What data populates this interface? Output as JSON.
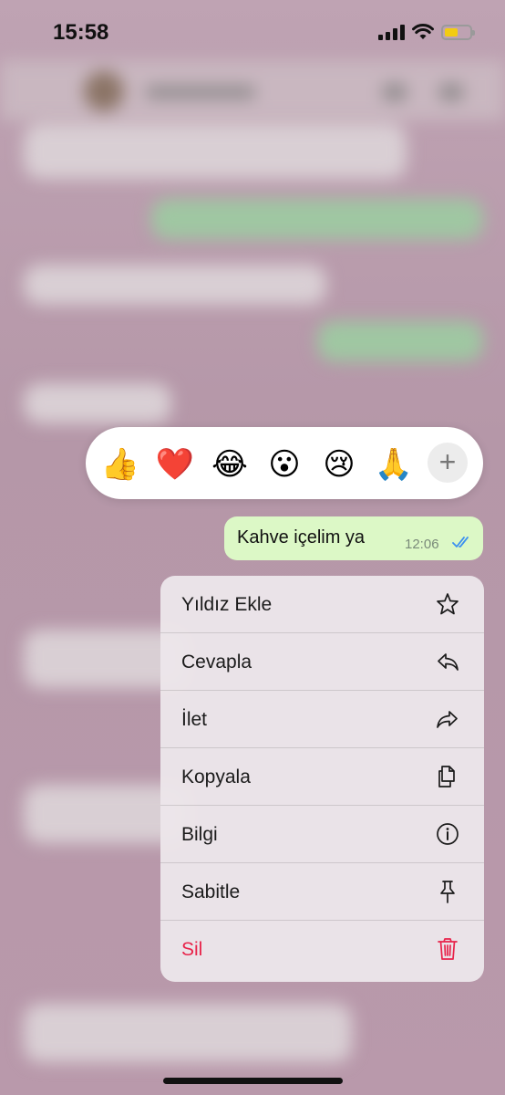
{
  "status_bar": {
    "time": "15:58",
    "battery_level": 0.55,
    "battery_color": "#f2cc12"
  },
  "reactions": {
    "emojis": [
      {
        "glyph": "👍",
        "name": "thumbs-up"
      },
      {
        "glyph": "❤️",
        "name": "red-heart"
      },
      {
        "glyph": "😂",
        "name": "tears-of-joy"
      },
      {
        "glyph": "😮",
        "name": "surprised-face"
      },
      {
        "glyph": "😢",
        "name": "crying-face"
      },
      {
        "glyph": "🙏",
        "name": "folded-hands"
      }
    ],
    "more_label": "+"
  },
  "message": {
    "text": "Kahve içelim ya",
    "time": "12:06",
    "status_icon": "double-check-read-icon",
    "tick_color": "#3a8ff0",
    "bubble_color": "#dcf8c6"
  },
  "menu": {
    "items": [
      {
        "label": "Yıldız Ekle",
        "icon": "star-icon"
      },
      {
        "label": "Cevapla",
        "icon": "reply-icon"
      },
      {
        "label": "İlet",
        "icon": "forward-icon"
      },
      {
        "label": "Kopyala",
        "icon": "copy-icon"
      },
      {
        "label": "Bilgi",
        "icon": "info-icon"
      },
      {
        "label": "Sabitle",
        "icon": "pin-icon"
      },
      {
        "label": "Sil",
        "icon": "trash-icon",
        "destructive": true
      }
    ],
    "danger_color": "#e8234a"
  }
}
